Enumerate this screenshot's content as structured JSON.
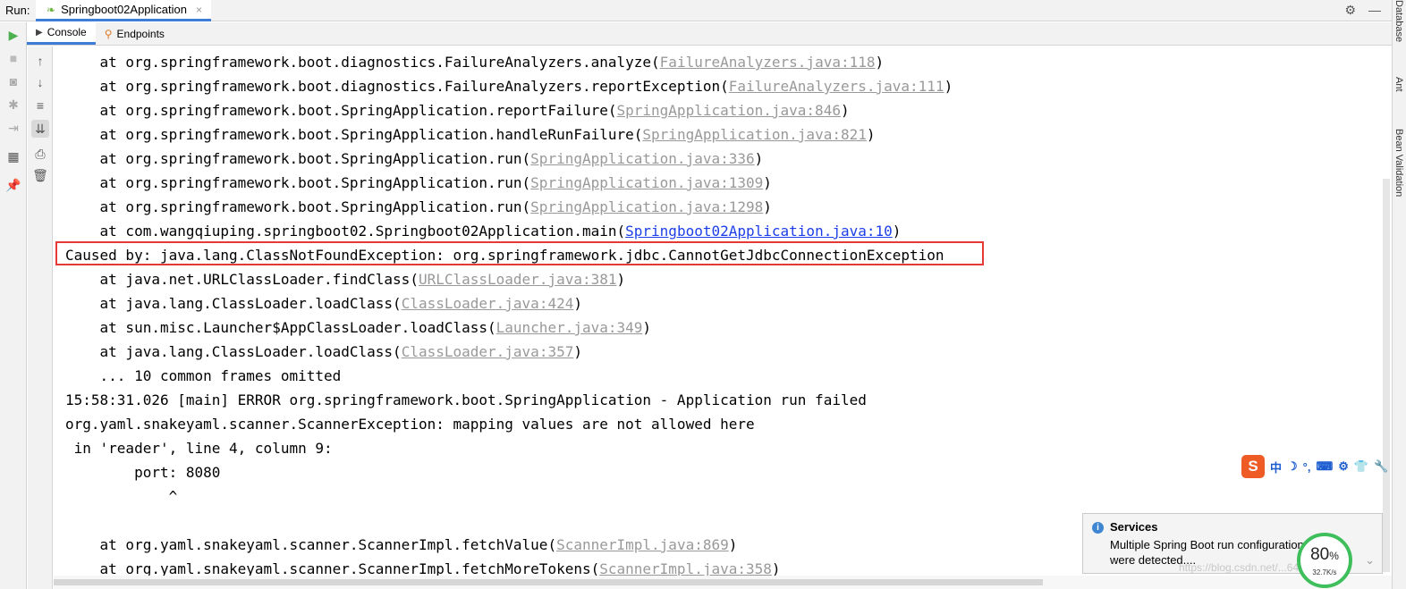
{
  "header": {
    "run_label": "Run:",
    "tab_label": "Springboot02Application",
    "tab_close": "×"
  },
  "subtabs": [
    {
      "label": "Console",
      "active": true
    },
    {
      "label": "Endpoints",
      "active": false
    }
  ],
  "right_sidebar": [
    "Database",
    "Ant",
    "Bean Validation"
  ],
  "console": {
    "lines": [
      {
        "pre": "    at org.springframework.boot.diagnostics.FailureAnalyzers.analyze(",
        "link": "FailureAnalyzers.java:118",
        "post": ")"
      },
      {
        "pre": "    at org.springframework.boot.diagnostics.FailureAnalyzers.reportException(",
        "link": "FailureAnalyzers.java:111",
        "post": ")"
      },
      {
        "pre": "    at org.springframework.boot.SpringApplication.reportFailure(",
        "link": "SpringApplication.java:846",
        "post": ")"
      },
      {
        "pre": "    at org.springframework.boot.SpringApplication.handleRunFailure(",
        "link": "SpringApplication.java:821",
        "post": ")"
      },
      {
        "pre": "    at org.springframework.boot.SpringApplication.run(",
        "link": "SpringApplication.java:336",
        "post": ")"
      },
      {
        "pre": "    at org.springframework.boot.SpringApplication.run(",
        "link": "SpringApplication.java:1309",
        "post": ")"
      },
      {
        "pre": "    at org.springframework.boot.SpringApplication.run(",
        "link": "SpringApplication.java:1298",
        "post": ")"
      },
      {
        "pre": "    at com.wangqiuping.springboot02.Springboot02Application.main(",
        "link": "Springboot02Application.java:10",
        "post": ")",
        "blue": true
      },
      {
        "pre": "Caused by: java.lang.ClassNotFoundException: org.springframework.jdbc.CannotGetJdbcConnectionException",
        "link": "",
        "post": ""
      },
      {
        "pre": "    at java.net.URLClassLoader.findClass(",
        "link": "URLClassLoader.java:381",
        "post": ")"
      },
      {
        "pre": "    at java.lang.ClassLoader.loadClass(",
        "link": "ClassLoader.java:424",
        "post": ")"
      },
      {
        "pre": "    at sun.misc.Launcher$AppClassLoader.loadClass(",
        "link": "Launcher.java:349",
        "post": ")"
      },
      {
        "pre": "    at java.lang.ClassLoader.loadClass(",
        "link": "ClassLoader.java:357",
        "post": ")"
      },
      {
        "pre": "    ... 10 common frames omitted",
        "link": "",
        "post": ""
      },
      {
        "pre": "15:58:31.026 [main] ERROR org.springframework.boot.SpringApplication - Application run failed",
        "link": "",
        "post": ""
      },
      {
        "pre": "org.yaml.snakeyaml.scanner.ScannerException: mapping values are not allowed here",
        "link": "",
        "post": ""
      },
      {
        "pre": " in 'reader', line 4, column 9:",
        "link": "",
        "post": ""
      },
      {
        "pre": "        port: 8080",
        "link": "",
        "post": ""
      },
      {
        "pre": "            ^",
        "link": "",
        "post": ""
      },
      {
        "pre": "",
        "link": "",
        "post": ""
      },
      {
        "pre": "    at org.yaml.snakeyaml.scanner.ScannerImpl.fetchValue(",
        "link": "ScannerImpl.java:869",
        "post": ")"
      },
      {
        "pre": "    at org.yaml.snakeyaml.scanner.ScannerImpl.fetchMoreTokens(",
        "link": "ScannerImpl.java:358",
        "post": ")"
      }
    ]
  },
  "ime_toolbar": {
    "logo": "S",
    "items": [
      "中",
      "☽",
      "°,",
      "⌨",
      "⚙",
      "👕",
      "🔧"
    ]
  },
  "notification": {
    "title": "Services",
    "line1": "Multiple Spring Boot run configurations",
    "line2": "were detected....",
    "chevron": "⌄"
  },
  "net_gauge": {
    "percent": "80",
    "percent_unit": "%",
    "speed": "32.7K/s",
    "percent_value": 0.8
  },
  "watermark": "https://blog.csdn.net/...64930",
  "colors": {
    "accent": "#3d7dd8",
    "highlight_border": "#e53935",
    "link_gray": "#999999",
    "link_blue": "#1c3ee8",
    "gauge_green": "#3fbf5c"
  }
}
